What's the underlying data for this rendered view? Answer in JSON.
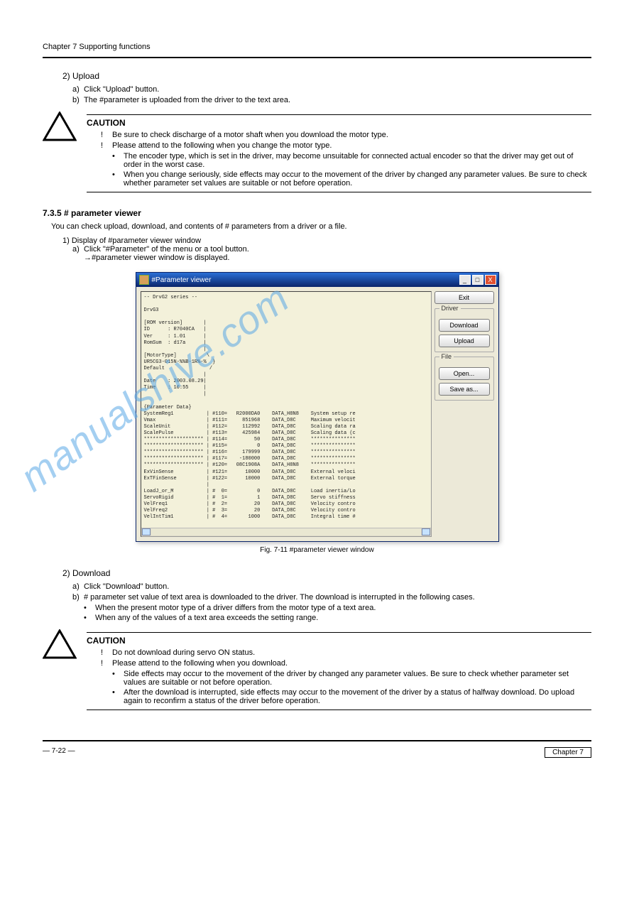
{
  "page": {
    "title": "Chapter 7 Supporting functions",
    "chapter_right": "Chapter 7",
    "page_no": "— 7-22 —"
  },
  "upload_section": {
    "heading": "2) Upload",
    "steps": {
      "a": "Click \"Upload\" button.",
      "b": "The #parameter is uploaded from the driver to the text area."
    }
  },
  "caution1": {
    "label": "CAUTION",
    "items": [
      "Be sure to check discharge of a motor shaft when you download the motor type.",
      {
        "text": "Please attend to the following when you change the motor type.",
        "subs": [
          "The encoder type, which is set in the driver, may become unsuitable for connected actual encoder so that the driver may get out of order in the worst case.",
          "When you change seriously, side effects may occur to the movement of the driver by changed any parameter values. Be sure to check whether parameter set values are suitable or not before operation."
        ]
      }
    ]
  },
  "procedure": {
    "heading": "7.3.5 # parameter viewer",
    "p1": "You can check upload, download, and contents of # parameters from a driver or a file.",
    "step1": "1) Display of #parameter viewer window",
    "stepA": "Click \"#Parameter\" of the menu or a tool button.\n→#parameter viewer window is displayed.",
    "caption": "Fig. 7-11 #parameter viewer window"
  },
  "win": {
    "title": "#Parameter viewer",
    "buttons": {
      "exit": "Exit"
    },
    "groups": {
      "driver": {
        "label": "Driver",
        "download": "Download",
        "upload": "Upload"
      },
      "file": {
        "label": "File",
        "open": "Open...",
        "save": "Save as..."
      }
    },
    "text": "-- DrvG2 series --\n\nDrvG3\n\n[ROM version]       |\nID      : R7040CA   |\nVer     : 1.01      |\nRomSum  : d17a      |\n                    |\n[MotorType]          \\\nUR5CG3-015N-%%B-1R%-%  }\nDefault               /\n                    |\nDate    : 2003.08.29|\nTime    : 10:55     |\n                    |\n\n{Parameter Data}\nSystemReg1           | #110=   R2000DA0    DATA_H8N8    System setup re\nVmax                 | #111=     851968    DATA_D8C     Maximum velocit\nScaleUnit            | #112=     112992    DATA_D8C     Scaling data ra\nScalePulse           | #113=     425984    DATA_D8C     Scaling data (c\n******************** | #114=         50    DATA_D8C     ***************\n******************** | #115=          0    DATA_D8C     ***************\n******************** | #116=     179999    DATA_D8C     ***************\n******************** | #117=    -180000    DATA_D8C     ***************\n******************** | #120=   08C1908A    DATA_H8N8    ***************\nExVinSense           | #121=      10000    DATA_D8C     External veloci\nExTFinSense          | #122=      10000    DATA_D8C     External torque\n                     |\nLoadJ_or_M           | #  0=          0    DATA_D8C     Load inertia/Lo\nServoRigid           | #  1=          1    DATA_D8C     Servo stiffness\nVelFreq1             | #  2=         20    DATA_D8C     Velocity contro\nVelFreq2             | #  3=         20    DATA_D8C     Velocity contro\nVelIntTim1           | #  4=       1000    DATA_D8C     Integral time #"
  },
  "download_section": {
    "heading": "2) Download",
    "steps": {
      "a": "Click \"Download\" button.",
      "b": "# parameter set value of text area is downloaded to the driver. The download is interrupted in the following cases.",
      "b_subs": [
        "When the present motor type of a driver differs from the motor type of a text area.",
        "When any of the values of a text area exceeds the setting range."
      ]
    }
  },
  "caution2": {
    "label": "CAUTION",
    "items": [
      "Do not download during servo ON status.",
      {
        "text": "Please attend to the following when you download.",
        "subs": [
          "Side effects may occur to the movement of the driver by changed any parameter values. Be sure to check whether parameter set values are suitable or not before operation.",
          "After the download is interrupted, side effects may occur to the movement of the driver by a status of halfway download. Do upload again to reconfirm a status of the driver before operation."
        ]
      }
    ]
  },
  "watermark": "manualshive.com"
}
